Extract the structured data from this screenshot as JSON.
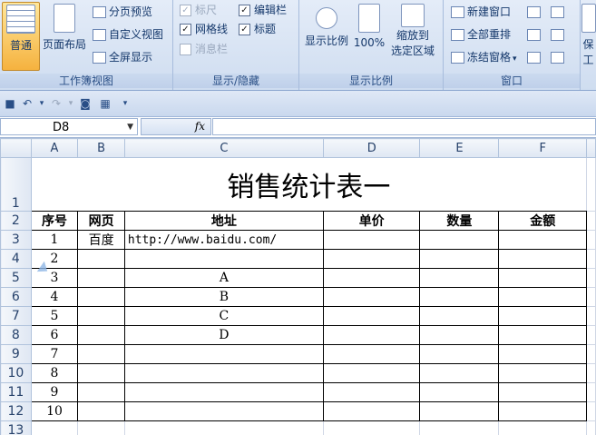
{
  "ribbon": {
    "workbook_views": {
      "group_label": "工作簿视图",
      "normal": "普通",
      "page_layout": "页面布局",
      "page_break_preview": "分页预览",
      "custom_views": "自定义视图",
      "full_screen": "全屏显示"
    },
    "show_hide": {
      "group_label": "显示/隐藏",
      "ruler": "标尺",
      "gridlines": "网格线",
      "message_bar": "消息栏",
      "formula_bar": "编辑栏",
      "headings": "标题",
      "check": "✓"
    },
    "zoom": {
      "group_label": "显示比例",
      "zoom": "显示比例",
      "zoom_100": "100%",
      "zoom_selection_line1": "缩放到",
      "zoom_selection_line2": "选定区域"
    },
    "window": {
      "group_label": "窗口",
      "new_window": "新建窗口",
      "arrange_all": "全部重排",
      "freeze_panes": "冻结窗格",
      "freeze_arrow": "▾",
      "save_workspace": "保",
      "work_label": "工作"
    }
  },
  "qat": {
    "save": "■",
    "undo": "↶",
    "undo_dd": "▾",
    "redo": "↷",
    "redo_dd": "▾",
    "preview": "◙",
    "custom": "▦",
    "more": "▾"
  },
  "formula_bar": {
    "name_box": "D8",
    "name_dd": "▼",
    "fx": "fx",
    "content": ""
  },
  "columns": [
    "A",
    "B",
    "C",
    "D",
    "E",
    "F"
  ],
  "rows": [
    "1",
    "2",
    "3",
    "4",
    "5",
    "6",
    "7",
    "8",
    "9",
    "10",
    "11",
    "12",
    "13"
  ],
  "sheet": {
    "title": "销售统计表一",
    "headers": [
      "序号",
      "网页",
      "地址",
      "单价",
      "数量",
      "金额"
    ],
    "data": [
      [
        "1",
        "百度",
        "http://www.baidu.com/",
        "",
        "",
        ""
      ],
      [
        "2",
        "",
        "",
        "",
        "",
        ""
      ],
      [
        "3",
        "",
        "A",
        "",
        "",
        ""
      ],
      [
        "4",
        "",
        "B",
        "",
        "",
        ""
      ],
      [
        "5",
        "",
        "C",
        "",
        "",
        ""
      ],
      [
        "6",
        "",
        "D",
        "",
        "",
        ""
      ],
      [
        "7",
        "",
        "",
        "",
        "",
        ""
      ],
      [
        "8",
        "",
        "",
        "",
        "",
        ""
      ],
      [
        "9",
        "",
        "",
        "",
        "",
        ""
      ],
      [
        "10",
        "",
        "",
        "",
        "",
        ""
      ],
      [
        "",
        "",
        "",
        "",
        "",
        ""
      ]
    ]
  }
}
